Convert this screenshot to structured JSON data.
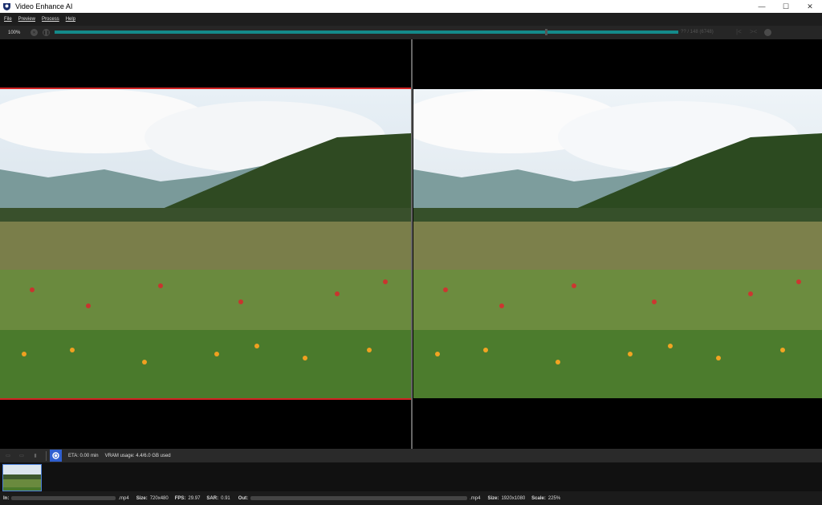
{
  "window": {
    "title": "Video Enhance AI",
    "minimize": "—",
    "maximize": "☐",
    "close": "✕"
  },
  "menu": [
    "File",
    "Preview",
    "Process",
    "Help"
  ],
  "toolbar": {
    "zoom": "100%",
    "frame_count": "?? / 148 (6748)"
  },
  "bottom_toolbar": {
    "eta": "ETA:  0.00 min",
    "vram": "VRAM usage:  4.4/6.0 GB used"
  },
  "status": {
    "in_label": "In:",
    "in_ext": ".mp4",
    "size_label": "Size:",
    "size": "720x480",
    "fps_label": "FPS:",
    "fps": "29.97",
    "sar_label": "SAR:",
    "sar": "0.91",
    "out_label": "Out:",
    "out_ext": ".mp4",
    "out_size_label": "Size:",
    "out_size": "1920x1080",
    "scale_label": "Scale:",
    "scale": "225%"
  }
}
